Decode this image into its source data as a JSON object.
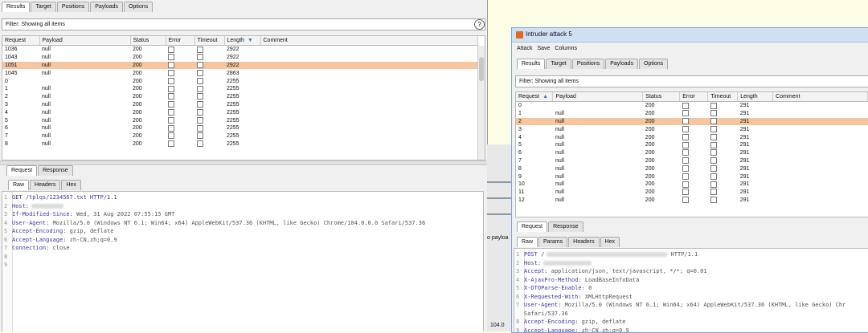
{
  "back": {
    "tabs": [
      "Results",
      "Target",
      "Positions",
      "Payloads",
      "Options"
    ],
    "filter": "Filter: Showing all items",
    "columns": [
      "Request",
      "Payload",
      "Status",
      "Error",
      "Timeout",
      "Length",
      "Comment"
    ],
    "rows": [
      {
        "request": "1036",
        "payload": "null",
        "status": "200",
        "length": "2922",
        "sel": false
      },
      {
        "request": "1043",
        "payload": "null",
        "status": "200",
        "length": "2922",
        "sel": false
      },
      {
        "request": "1051",
        "payload": "null",
        "status": "200",
        "length": "2922",
        "sel": true
      },
      {
        "request": "1045",
        "payload": "null",
        "status": "200",
        "length": "2863",
        "sel": false
      },
      {
        "request": "0",
        "payload": "",
        "status": "200",
        "length": "2255",
        "sel": false
      },
      {
        "request": "1",
        "payload": "null",
        "status": "200",
        "length": "2255",
        "sel": false
      },
      {
        "request": "2",
        "payload": "null",
        "status": "200",
        "length": "2255",
        "sel": false
      },
      {
        "request": "3",
        "payload": "null",
        "status": "200",
        "length": "2255",
        "sel": false
      },
      {
        "request": "4",
        "payload": "null",
        "status": "200",
        "length": "2255",
        "sel": false
      },
      {
        "request": "5",
        "payload": "null",
        "status": "200",
        "length": "2255",
        "sel": false
      },
      {
        "request": "6",
        "payload": "null",
        "status": "200",
        "length": "2255",
        "sel": false
      },
      {
        "request": "7",
        "payload": "null",
        "status": "200",
        "length": "2255",
        "sel": false
      },
      {
        "request": "8",
        "payload": "null",
        "status": "200",
        "length": "2255",
        "sel": false
      }
    ],
    "reqresp_tabs": [
      "Request",
      "Response"
    ],
    "view_tabs": [
      "Raw",
      "Headers",
      "Hex"
    ],
    "lines": [
      {
        "n": "1",
        "k": "GET /tplqs/1234567.txt HTTP/1.1",
        "v": "",
        "blur": 0
      },
      {
        "n": "2",
        "k": "Host:",
        "v": "",
        "blur": 40
      },
      {
        "n": "3",
        "k": "If-Modified-Since:",
        "v": " Wed, 31 Aug 2022 07:55:15 GMT",
        "blur": 0
      },
      {
        "n": "4",
        "k": "User-Agent:",
        "v": " Mozilla/5.0 (Windows NT 6.1; Win64; x64) AppleWebKit/537.36 (KHTML, like Gecko) Chrome/104.0.0.0 Safari/537.36",
        "blur": 0
      },
      {
        "n": "5",
        "k": "Accept-Encoding:",
        "v": " gzip, deflate",
        "blur": 0
      },
      {
        "n": "6",
        "k": "Accept-Language:",
        "v": " zh-CN,zh;q=0.9",
        "blur": 0
      },
      {
        "n": "7",
        "k": "Connection:",
        "v": " close",
        "blur": 0
      },
      {
        "n": "8",
        "k": "",
        "v": "",
        "blur": 0
      },
      {
        "n": "9",
        "k": "",
        "v": "",
        "blur": 0
      }
    ]
  },
  "strip": {
    "text1": "o payloa",
    "text2": "104.0"
  },
  "front": {
    "title": "Intruder attack 5",
    "menu": [
      "Attack",
      "Save",
      "Columns"
    ],
    "tabs": [
      "Results",
      "Target",
      "Positions",
      "Payloads",
      "Options"
    ],
    "filter": "Filter: Showing all items",
    "columns": [
      "Request",
      "Payload",
      "Status",
      "Error",
      "Timeout",
      "Length",
      "Comment"
    ],
    "rows": [
      {
        "request": "0",
        "payload": "",
        "status": "200",
        "length": "291",
        "sel": false
      },
      {
        "request": "1",
        "payload": "null",
        "status": "200",
        "length": "291",
        "sel": false
      },
      {
        "request": "2",
        "payload": "null",
        "status": "200",
        "length": "291",
        "sel": true
      },
      {
        "request": "3",
        "payload": "null",
        "status": "200",
        "length": "291",
        "sel": false
      },
      {
        "request": "4",
        "payload": "null",
        "status": "200",
        "length": "291",
        "sel": false
      },
      {
        "request": "5",
        "payload": "null",
        "status": "200",
        "length": "291",
        "sel": false
      },
      {
        "request": "6",
        "payload": "null",
        "status": "200",
        "length": "291",
        "sel": false
      },
      {
        "request": "7",
        "payload": "null",
        "status": "200",
        "length": "291",
        "sel": false
      },
      {
        "request": "8",
        "payload": "null",
        "status": "200",
        "length": "291",
        "sel": false
      },
      {
        "request": "9",
        "payload": "null",
        "status": "200",
        "length": "291",
        "sel": false
      },
      {
        "request": "10",
        "payload": "null",
        "status": "200",
        "length": "291",
        "sel": false
      },
      {
        "request": "11",
        "payload": "null",
        "status": "200",
        "length": "291",
        "sel": false
      },
      {
        "request": "12",
        "payload": "null",
        "status": "200",
        "length": "291",
        "sel": false
      }
    ],
    "reqresp_tabs": [
      "Request",
      "Response"
    ],
    "view_tabs": [
      "Raw",
      "Params",
      "Headers",
      "Hex"
    ],
    "lines": [
      {
        "n": "1",
        "k": "POST /",
        "v": " HTTP/1.1",
        "blur": 150
      },
      {
        "n": "2",
        "k": "Host:",
        "v": "",
        "blur": 60
      },
      {
        "n": "3",
        "k": "Accept:",
        "v": " application/json, text/javascript, */*; q=0.01",
        "blur": 0
      },
      {
        "n": "4",
        "k": "X-AjaxPro-Method:",
        "v": " LoadBaseInfoData",
        "blur": 0
      },
      {
        "n": "5",
        "k": "X-DTOParse-Enable:",
        "v": " 0",
        "blur": 0
      },
      {
        "n": "6",
        "k": "X-Requested-With:",
        "v": " XMLHttpRequest",
        "blur": 0
      },
      {
        "n": "7",
        "k": "User-Agent:",
        "v": " Mozilla/5.0 (Windows NT 6.1; Win64; x64) AppleWebKit/537.36 (KHTML, like Gecko) Chr",
        "blur": 0
      },
      {
        "n": "",
        "k": "",
        "v": "Safari/537.36",
        "blur": 0
      },
      {
        "n": "8",
        "k": "Accept-Encoding:",
        "v": " gzip, deflate",
        "blur": 0
      },
      {
        "n": "9",
        "k": "Accept-Language:",
        "v": " zh-CN,zh;q=0.9",
        "blur": 0
      }
    ]
  }
}
